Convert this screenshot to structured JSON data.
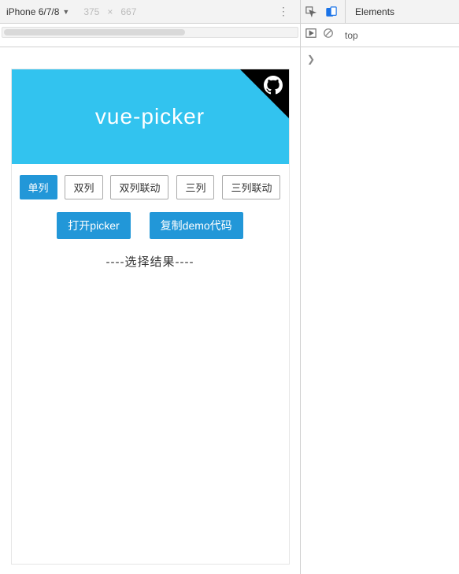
{
  "toolbar": {
    "device": "iPhone 6/7/8",
    "width": "375",
    "height": "667",
    "elements_tab": "Elements",
    "context": "top"
  },
  "app": {
    "title": "vue-picker",
    "tabs": [
      "单列",
      "双列",
      "双列联动",
      "三列",
      "三列联动"
    ],
    "active_tab_index": 0,
    "open_btn": "打开picker",
    "copy_btn": "复制demo代码",
    "result_label": "----选择结果----"
  }
}
